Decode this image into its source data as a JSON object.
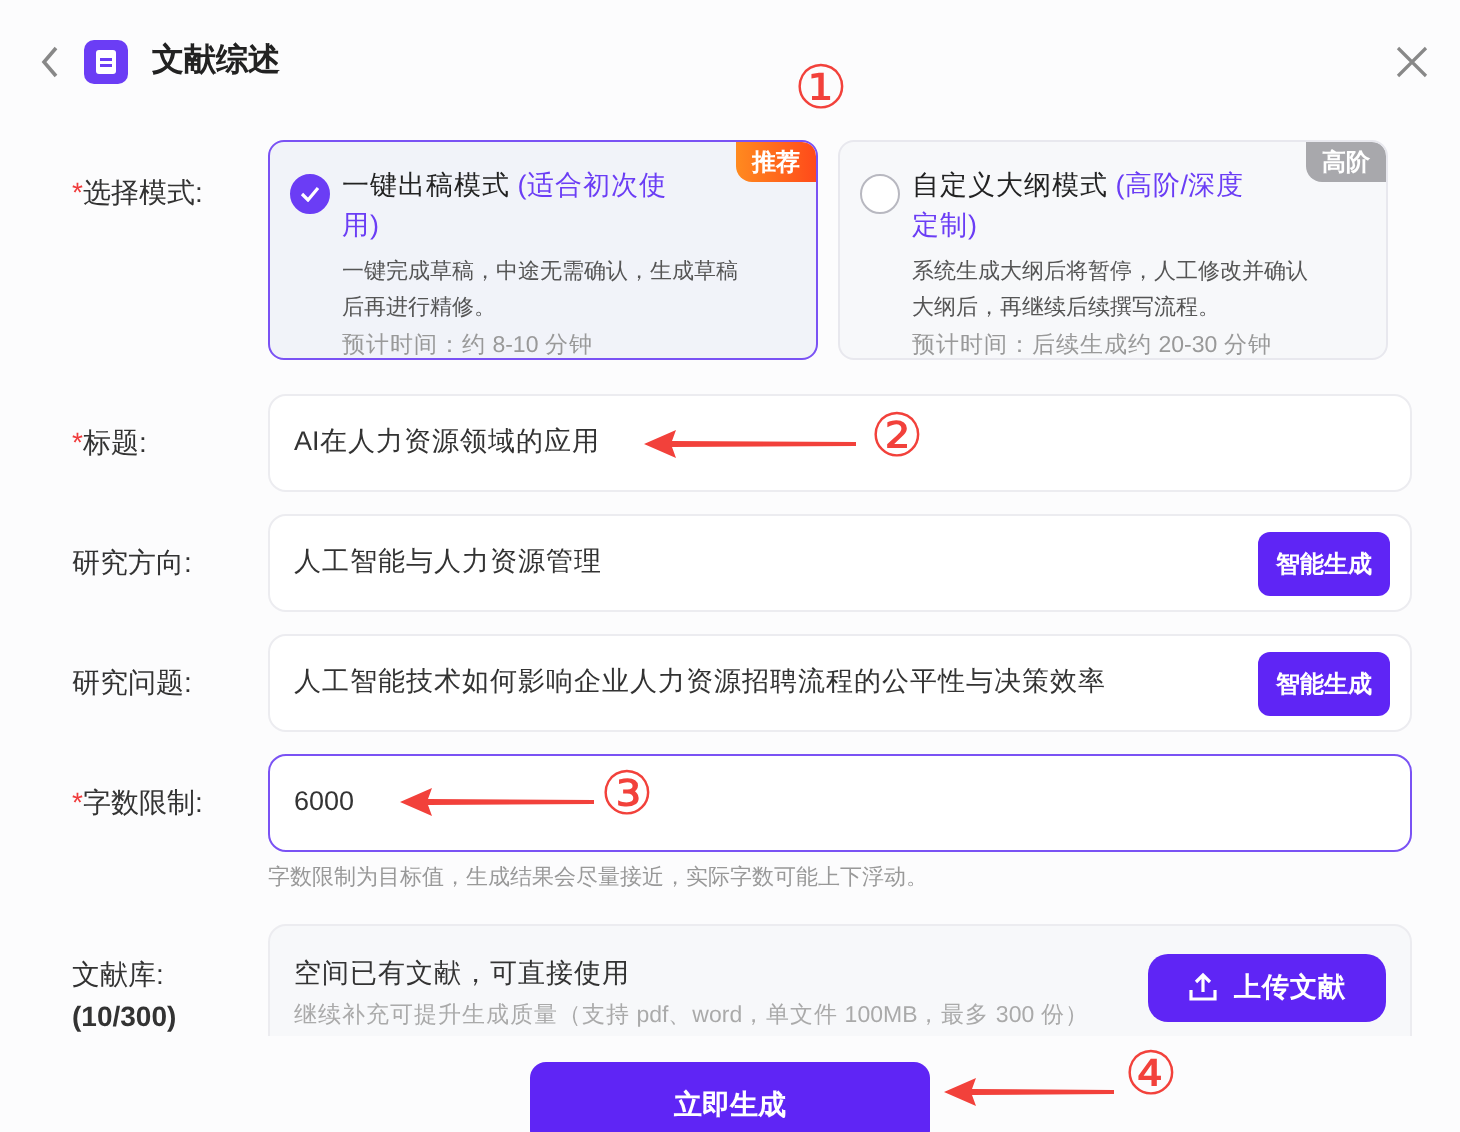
{
  "header": {
    "title": "文献综述"
  },
  "mode": {
    "label": "选择模式:",
    "required_mark": "*",
    "options": [
      {
        "title": "一键出稿模式",
        "note": "(适合初次使用)",
        "desc": "一键完成草稿，中途无需确认，生成草稿后再进行精修。",
        "time": "预计时间：约 8-10 分钟",
        "tag": "推荐",
        "kind": "recommend",
        "selected": true
      },
      {
        "title": "自定义大纲模式",
        "note": "(高阶/深度定制)",
        "desc": "系统生成大纲后将暂停，人工修改并确认大纲后，再继续后续撰写流程。",
        "time": "预计时间：后续生成约 20-30 分钟",
        "tag": "高阶",
        "kind": "advanced",
        "selected": false
      }
    ]
  },
  "fields": [
    {
      "label": "标题:",
      "required_mark": "*",
      "value": "AI在人力资源领域的应用",
      "focused": false
    },
    {
      "label": "研究方向:",
      "value": "人工智能与人力资源管理",
      "focused": false,
      "button": "智能生成"
    },
    {
      "label": "研究问题:",
      "value": "人工智能技术如何影响企业人力资源招聘流程的公平性与决策效率",
      "focused": false,
      "button": "智能生成"
    },
    {
      "label": "字数限制:",
      "required_mark": "*",
      "value": "6000",
      "focused": true,
      "hint": "字数限制为目标值，生成结果会尽量接近，实际字数可能上下浮动。"
    }
  ],
  "library": {
    "label": "文献库:",
    "count": "(10/300)",
    "title": "空间已有文献，可直接使用",
    "desc": "继续补充可提升生成质量（支持 pdf、word，单文件 100MB，最多 300 份）",
    "button": "上传文献"
  },
  "submit": "立即生成",
  "annotations": [
    {
      "text": "①",
      "arrow": false
    },
    {
      "text": "②",
      "arrow": true
    },
    {
      "text": "③",
      "arrow": true
    },
    {
      "text": "④",
      "arrow": true
    }
  ]
}
